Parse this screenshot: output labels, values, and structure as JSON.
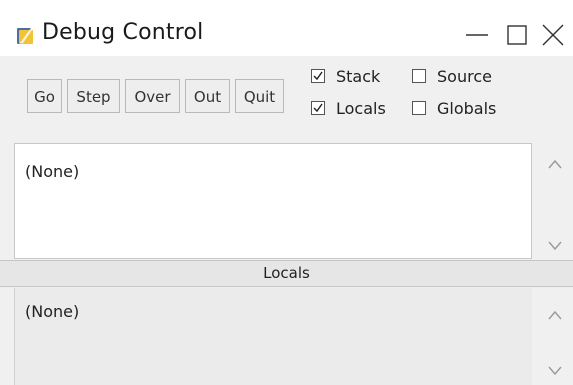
{
  "window": {
    "title": "Debug Control",
    "icon": "python-feather-icon",
    "controls": [
      "minimize-icon",
      "maximize-icon",
      "close-icon"
    ]
  },
  "toolbar": {
    "buttons": [
      "Go",
      "Step",
      "Over",
      "Out",
      "Quit"
    ],
    "checkboxes": [
      {
        "label": "Stack",
        "checked": true
      },
      {
        "label": "Source",
        "checked": false
      },
      {
        "label": "Locals",
        "checked": true
      },
      {
        "label": "Globals",
        "checked": false
      }
    ]
  },
  "stack_panel": {
    "text": "(None)"
  },
  "locals_panel": {
    "header": "Locals",
    "text": "(None)"
  }
}
